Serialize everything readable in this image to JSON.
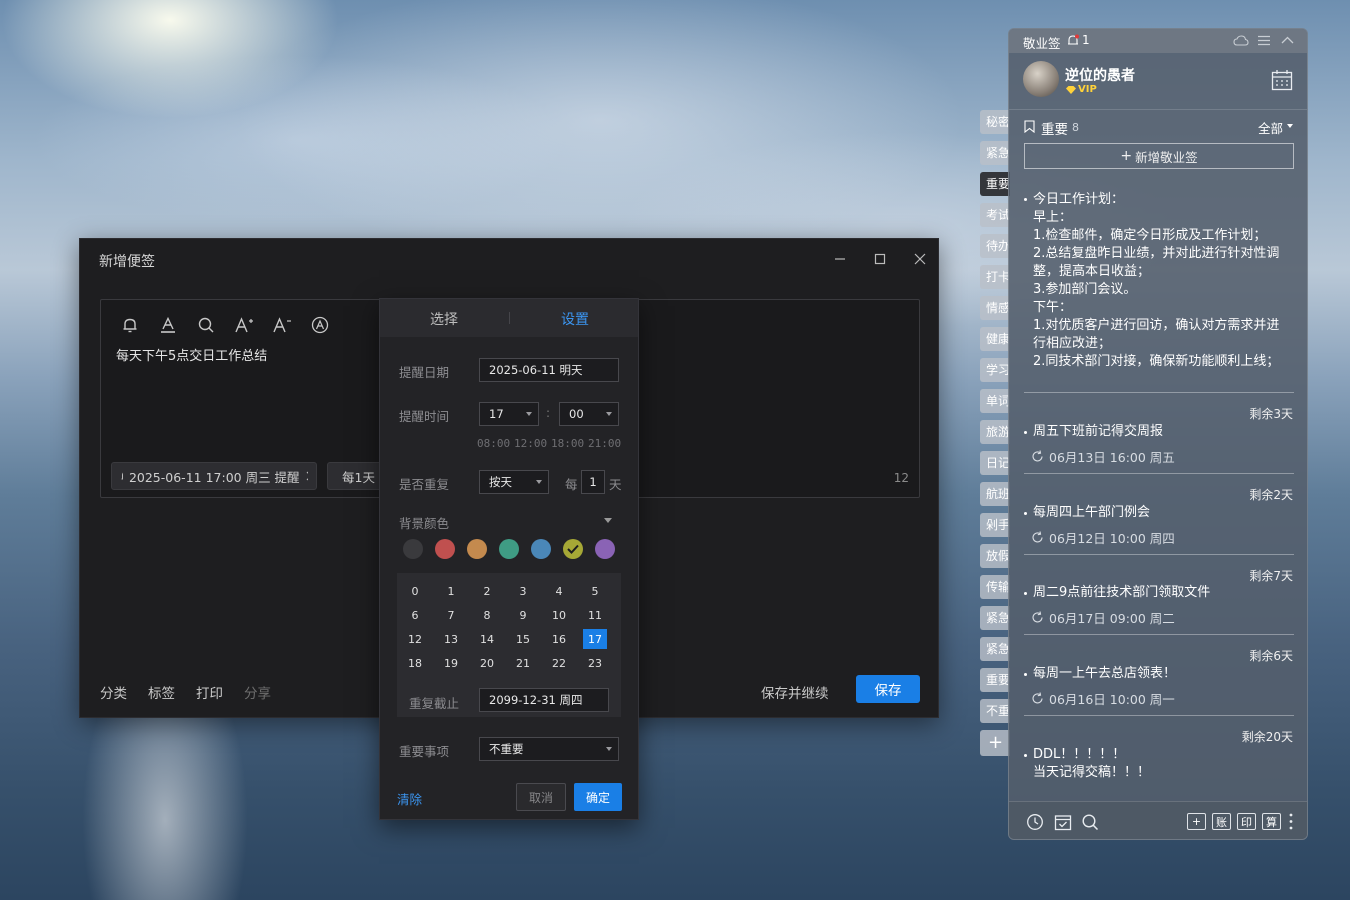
{
  "dialog": {
    "title": "新增便签",
    "note_text": "每天下午5点交日工作总结",
    "chip_reminder": "2025-06-11 17:00 周三 提醒",
    "chip_repeat": "每1天",
    "char_count": "12",
    "bottom_links": [
      "分类",
      "标签",
      "打印",
      "分享"
    ],
    "save_continue": "保存并继续",
    "save": "保存"
  },
  "popup": {
    "tabs": [
      "选择",
      "设置"
    ],
    "active_tab": "设置",
    "remind_date_label": "提醒日期",
    "remind_date_value": "2025-06-11 明天",
    "remind_time_label": "提醒时间",
    "hour": "17",
    "minute": "00",
    "time_sep": ":",
    "quick_times": [
      "08:00",
      "12:00",
      "18:00",
      "21:00"
    ],
    "repeat_label": "是否重复",
    "repeat_mode": "按天",
    "every_label": "每",
    "every_value": "1",
    "every_unit": "天",
    "bg_color_label": "背景颜色",
    "colors": [
      "#3a3a3d",
      "#c0504f",
      "#c48a4e",
      "#3f9c84",
      "#4a87b8",
      "#a6a836",
      "#8a63b5"
    ],
    "selected_color": "#a6a836",
    "hours": [
      "0",
      "1",
      "2",
      "3",
      "4",
      "5",
      "6",
      "7",
      "8",
      "9",
      "10",
      "11",
      "12",
      "13",
      "14",
      "15",
      "16",
      "17",
      "18",
      "19",
      "20",
      "21",
      "22",
      "23"
    ],
    "selected_hour": "17",
    "repeat_until_label": "重复截止",
    "repeat_until_value": "2099-12-31  周四",
    "importance_label": "重要事项",
    "importance_value": "不重要",
    "clear": "清除",
    "cancel": "取消",
    "ok": "确定"
  },
  "side_tabs": [
    "秘密",
    "紧急",
    "重要",
    "考试",
    "待办",
    "打卡",
    "情感",
    "健康",
    "学习",
    "单词",
    "旅游",
    "日记",
    "航班",
    "剁手",
    "放假",
    "传输",
    "紧急",
    "紧急",
    "重要",
    "不重"
  ],
  "active_side_tab": "重要",
  "panel": {
    "app_name": "敬业签",
    "notif_count": "1",
    "user": "逆位的愚者",
    "vip": "VIP",
    "category": "重要",
    "category_count": "8",
    "filter": "全部",
    "new_note": "新增敬业签",
    "notes": [
      {
        "lines": [
          "今日工作计划：",
          "早上：",
          "1.检查邮件，确定今日形成及工作计划；",
          "2.总结复盘昨日业绩，并对此进行针对性调",
          "整，提高本日收益；",
          "3.参加部门会议。",
          "下午：",
          "1.对优质客户进行回访，确认对方需求并进",
          "行相应改进；",
          "2.同技术部门对接，确保新功能顺利上线；"
        ]
      },
      {
        "remain": "剩余3天",
        "title": "周五下班前记得交周报",
        "meta": "06月13日 16:00 周五"
      },
      {
        "remain": "剩余2天",
        "title": "每周四上午部门例会",
        "meta": "06月12日 10:00 周四"
      },
      {
        "remain": "剩余7天",
        "title": "周二9点前往技术部门领取文件",
        "meta": "06月17日 09:00 周二"
      },
      {
        "remain": "剩余6天",
        "title": "每周一上午去总店领表！",
        "meta": "06月16日 10:00 周一"
      },
      {
        "remain": "剩余20天",
        "lines": [
          "DDL！！！！！",
          "当天记得交稿！！！"
        ]
      }
    ],
    "footer_boxes": [
      "+",
      "账",
      "印",
      "算"
    ]
  },
  "icons": [
    "bell-icon",
    "font-color-icon",
    "search-icon",
    "font-increase-icon",
    "font-decrease-icon",
    "format-icon",
    "minimize-icon",
    "maximize-icon",
    "close-icon",
    "calendar-icon",
    "repeat-icon",
    "clock-icon",
    "checklist-icon",
    "more-icon"
  ]
}
